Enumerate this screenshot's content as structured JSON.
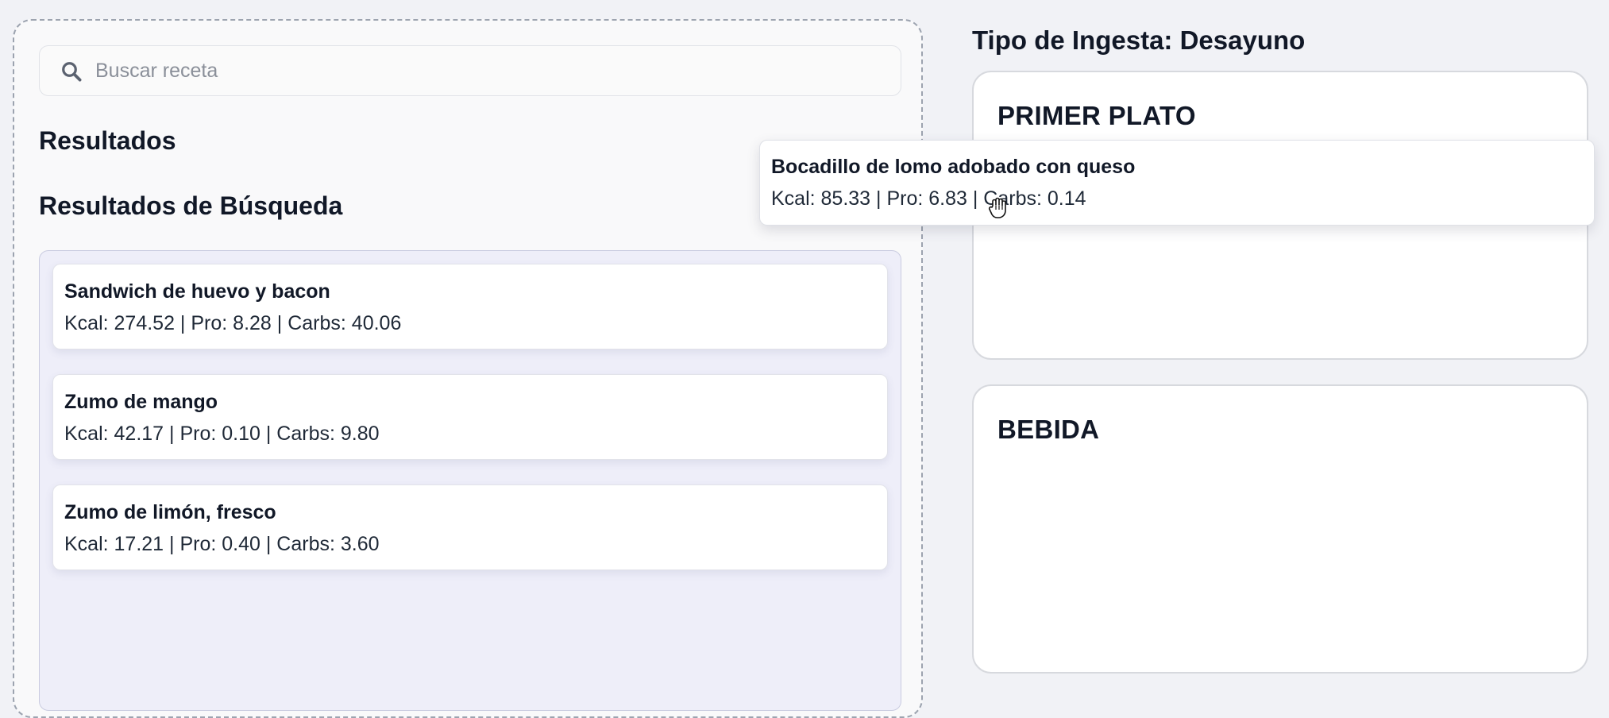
{
  "search": {
    "placeholder": "Buscar receta",
    "value": ""
  },
  "left": {
    "results_heading": "Resultados",
    "search_results_heading": "Resultados de Búsqueda",
    "recipes": [
      {
        "name": "Sandwich de huevo y bacon",
        "nutrition": "Kcal: 274.52 | Pro: 8.28 | Carbs: 40.06"
      },
      {
        "name": "Zumo de mango",
        "nutrition": "Kcal: 42.17 | Pro: 0.10 | Carbs: 9.80"
      },
      {
        "name": "Zumo de limón, fresco",
        "nutrition": "Kcal: 17.21 | Pro: 0.40 | Carbs: 3.60"
      }
    ]
  },
  "right": {
    "meal_type_title": "Tipo de Ingesta: Desayuno",
    "zones": [
      {
        "title": "PRIMER PLATO"
      },
      {
        "title": "BEBIDA"
      }
    ]
  },
  "dragged": {
    "name": "Bocadillo de lomo adobado con queso",
    "nutrition": "Kcal: 85.33 | Pro: 6.83 | Carbs: 0.14"
  },
  "icons": {
    "search": "search-icon",
    "cursor": "grab-hand-cursor-icon"
  },
  "colors": {
    "background": "#f1f2f6",
    "results_box": "#eeeef9",
    "card": "#ffffff",
    "text": "#111827"
  }
}
